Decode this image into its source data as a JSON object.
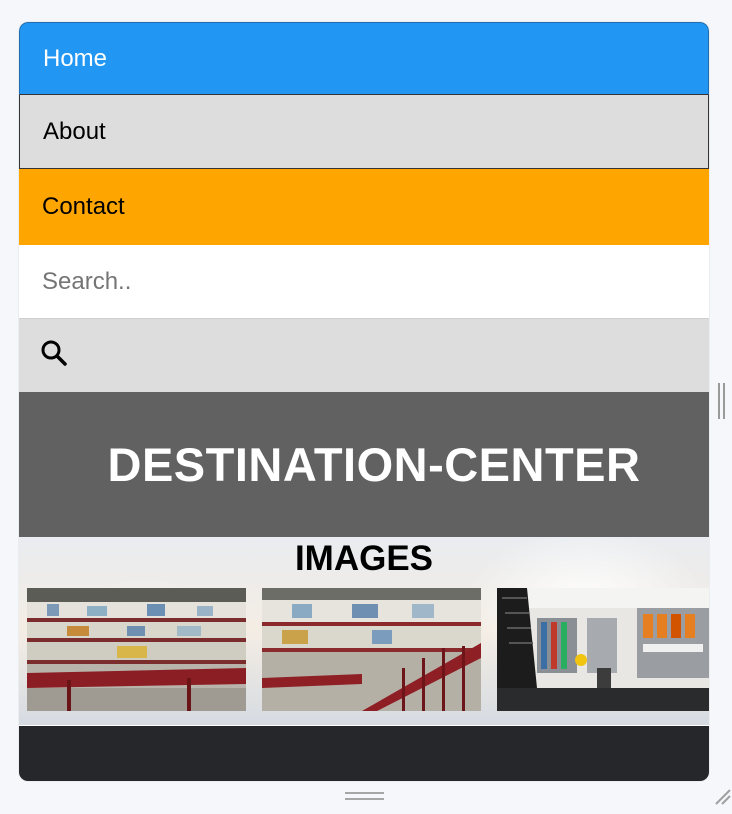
{
  "nav": {
    "home_label": "Home",
    "about_label": "About",
    "contact_label": "Contact"
  },
  "search": {
    "placeholder": "Search..",
    "value": "",
    "button_icon": "search-icon"
  },
  "banner": {
    "title": "DESTINATION-CENTER"
  },
  "gallery": {
    "title": "IMAGES",
    "images": [
      {
        "icon": "mall-atrium-photo"
      },
      {
        "icon": "mall-atrium-photo"
      },
      {
        "icon": "store-interior-photo"
      }
    ]
  },
  "colors": {
    "home_bg": "#2196f3",
    "about_bg": "#dddddd",
    "contact_bg": "#ffa500",
    "banner_bg": "#616161",
    "footer_bg": "#25272b"
  }
}
